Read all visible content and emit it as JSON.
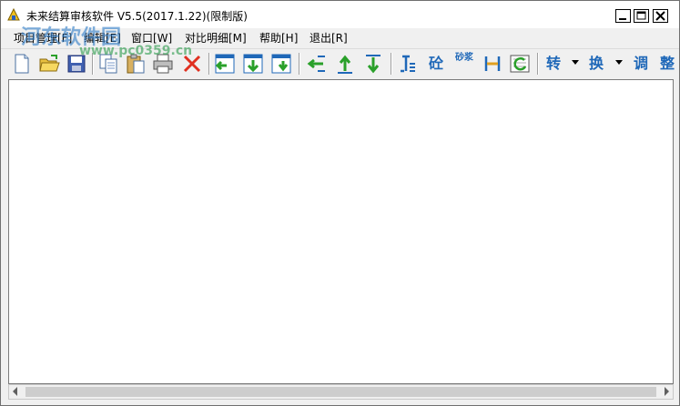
{
  "window": {
    "title": "未来结算审核软件 V5.5(2017.1.22)(限制版)",
    "controls": {
      "minimize": "_",
      "maximize": "☐",
      "close": "✕"
    }
  },
  "menu": {
    "items": [
      "项目管理[F]",
      "编辑[E]",
      "窗口[W]",
      "对比明细[M]",
      "帮助[H]",
      "退出[R]"
    ]
  },
  "toolbar": {
    "glyphs": {
      "zhuan": "转",
      "huan": "换",
      "tiao": "调",
      "zheng": "整",
      "tong": "砼",
      "sha": "砂浆"
    }
  },
  "watermark": {
    "line1": "河东软件园",
    "line2": "www.pc0359.cn"
  },
  "colors": {
    "accent": "#1f68b8",
    "danger": "#e03020",
    "green": "#2aa02a"
  }
}
